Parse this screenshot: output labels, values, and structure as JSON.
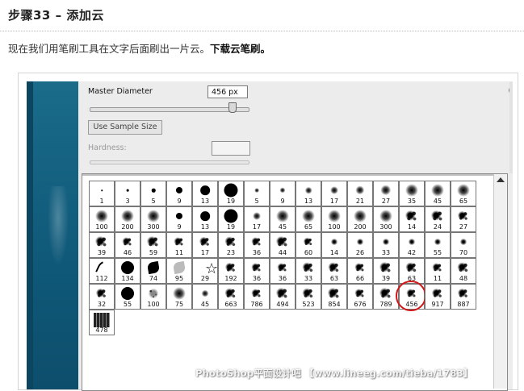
{
  "article": {
    "heading": "步骤33 – 添加云",
    "para_text": "现在我们用笔刷工具在文字后面刷出一片云。",
    "para_link": "下载云笔刷。"
  },
  "brush_options": {
    "master_diameter_label": "Master Diameter",
    "master_diameter_value": "456 px",
    "master_diameter_level": 0.9,
    "use_sample_size_label": "Use Sample Size",
    "hardness_label": "Hardness:",
    "hardness_value": ""
  },
  "presets": {
    "rows": [
      [
        "1",
        "3",
        "5",
        "9",
        "13",
        "19",
        "5",
        "9",
        "13",
        "17",
        "21",
        "27",
        "35",
        "45",
        "65"
      ],
      [
        "100",
        "200",
        "300",
        "9",
        "13",
        "19",
        "17",
        "45",
        "65",
        "100",
        "200",
        "300",
        "14",
        "24",
        "27"
      ],
      [
        "39",
        "46",
        "59",
        "11",
        "17",
        "23",
        "36",
        "44",
        "60",
        "14",
        "26",
        "33",
        "42",
        "55",
        "70"
      ],
      [
        "112",
        "134",
        "74",
        "95",
        "29",
        "192",
        "36",
        "36",
        "33",
        "63",
        "66",
        "39",
        "63",
        "11",
        "48"
      ],
      [
        "32",
        "55",
        "100",
        "75",
        "45",
        "663",
        "786",
        "494",
        "523",
        "854",
        "676",
        "789",
        "456",
        "917",
        "887"
      ],
      [
        "478"
      ]
    ],
    "selected": "456",
    "selected_color": "#d01818"
  },
  "watermark": "PhotoShop平面设计吧 【www.lineeg.com/tieba/1783】"
}
